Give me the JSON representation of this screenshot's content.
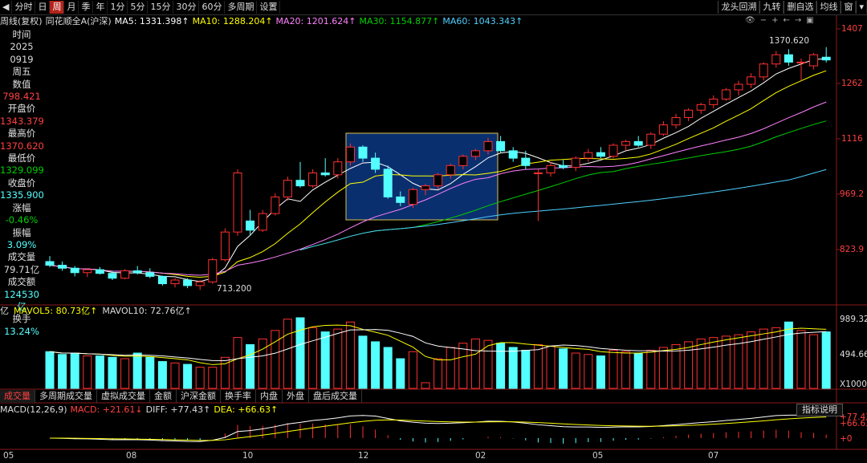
{
  "toolbar": {
    "left_icon": "back-icon",
    "periods": [
      "分时",
      "日",
      "周",
      "月",
      "季",
      "年",
      "1分",
      "5分",
      "15分",
      "30分",
      "60分",
      "多周期",
      "设置"
    ],
    "active_period": "周",
    "right": [
      "龙头回溯",
      "九转",
      "删自选",
      "均线",
      "窗"
    ],
    "more_icon": "chevron-down-icon"
  },
  "legend": {
    "mode": "周线(复权)",
    "name": "同花顺全A(沪深)",
    "ma5": "MA5: 1331.398↑",
    "ma10": "MA10: 1288.204↑",
    "ma20": "MA20: 1201.624↑",
    "ma30": "MA30: 1154.877↑",
    "ma60": "MA60: 1043.343↑"
  },
  "side": {
    "time_label": "时间",
    "year": "2025",
    "date": "0919",
    "weekday": "周五",
    "value_label": "数值",
    "value": "798.421",
    "open_label": "开盘价",
    "open": "1343.379",
    "high_label": "最高价",
    "high": "1370.620",
    "low_label": "最低价",
    "low": "1329.099",
    "close_label": "收盘价",
    "close": "1335.900",
    "chg_label": "涨幅",
    "chg": "-0.46%",
    "amp_label": "振幅",
    "amp": "3.09%",
    "vol_label": "成交量",
    "vol": "79.71亿",
    "amt_label": "成交额",
    "amt": "124530亿",
    "turn_label": "换手",
    "turn": "13.24%"
  },
  "price_axis": [
    "1407",
    "1262",
    "1116",
    "969.2",
    "823.9"
  ],
  "high_marker": "1370.620",
  "low_marker": "713.200",
  "vol_axis": [
    "989.32",
    "494.66",
    "X1000"
  ],
  "volume_legend": {
    "prefix": "亿",
    "mavol5": "MAVOL5: 80.73亿↑",
    "mavol10": "MAVOL10: 72.76亿↑"
  },
  "tabs": [
    "成交量",
    "多周期成交量",
    "虚拟成交量",
    "金额",
    "沪深金额",
    "换手率",
    "内盘",
    "外盘",
    "盘后成交量"
  ],
  "active_tab": "成交量",
  "macd": {
    "label": "MACD(12,26,9)",
    "macd": "MACD: +21.61↓",
    "diff": "DIFF: +77.43↑",
    "dea": "DEA: +66.63↑",
    "help": "指标说明",
    "axis": [
      "+77.43",
      "+66.63",
      "+0"
    ]
  },
  "months": [
    "05",
    "08",
    "10",
    "12",
    "02",
    "05",
    "07"
  ],
  "toolbar_icons": [
    "eye-icon",
    "minus-icon",
    "plus-icon",
    "left-icon",
    "right-icon",
    "expand-icon"
  ],
  "colors": {
    "up": "#ff3030",
    "down": "#54ffff",
    "ma5": "#ffffff",
    "ma10": "#ffff00",
    "ma20": "#ff80ff",
    "ma30": "#00d000",
    "ma60": "#4fd0ff",
    "highlight": "#0a2f6e"
  },
  "chart_data": {
    "type": "candlestick",
    "ylim": [
      690,
      1420
    ],
    "candles": [
      [
        790,
        805,
        775,
        780
      ],
      [
        780,
        790,
        765,
        772
      ],
      [
        772,
        778,
        750,
        760
      ],
      [
        760,
        770,
        748,
        768
      ],
      [
        768,
        775,
        755,
        758
      ],
      [
        758,
        765,
        740,
        745
      ],
      [
        745,
        770,
        742,
        765
      ],
      [
        765,
        778,
        755,
        760
      ],
      [
        760,
        772,
        745,
        750
      ],
      [
        750,
        752,
        725,
        730
      ],
      [
        730,
        745,
        720,
        740
      ],
      [
        740,
        745,
        718,
        725
      ],
      [
        725,
        740,
        713,
        735
      ],
      [
        735,
        800,
        730,
        795
      ],
      [
        795,
        880,
        790,
        870
      ],
      [
        870,
        1040,
        860,
        1030
      ],
      [
        900,
        930,
        860,
        875
      ],
      [
        875,
        930,
        870,
        920
      ],
      [
        920,
        975,
        915,
        965
      ],
      [
        965,
        1020,
        955,
        1010
      ],
      [
        1010,
        1060,
        990,
        995
      ],
      [
        995,
        1040,
        990,
        1030
      ],
      [
        1030,
        1070,
        1020,
        1025
      ],
      [
        1025,
        1070,
        1015,
        1060
      ],
      [
        1060,
        1110,
        1050,
        1100
      ],
      [
        1100,
        1105,
        1060,
        1070
      ],
      [
        1070,
        1085,
        1030,
        1040
      ],
      [
        1040,
        1050,
        960,
        965
      ],
      [
        965,
        980,
        940,
        950
      ],
      [
        945,
        990,
        935,
        985
      ],
      [
        985,
        1000,
        970,
        995
      ],
      [
        995,
        1030,
        985,
        1025
      ],
      [
        1025,
        1055,
        1015,
        1050
      ],
      [
        1050,
        1080,
        1040,
        1075
      ],
      [
        1075,
        1095,
        1065,
        1090
      ],
      [
        1090,
        1125,
        1080,
        1115
      ],
      [
        1115,
        1130,
        1085,
        1090
      ],
      [
        1090,
        1100,
        1060,
        1070
      ],
      [
        1070,
        1090,
        1040,
        1050
      ],
      [
        1030,
        1040,
        900,
        1030
      ],
      [
        1030,
        1060,
        1020,
        1050
      ],
      [
        1050,
        1065,
        1040,
        1045
      ],
      [
        1045,
        1075,
        1035,
        1070
      ],
      [
        1070,
        1095,
        1060,
        1085
      ],
      [
        1085,
        1100,
        1070,
        1075
      ],
      [
        1075,
        1110,
        1070,
        1105
      ],
      [
        1105,
        1120,
        1090,
        1115
      ],
      [
        1115,
        1130,
        1100,
        1105
      ],
      [
        1105,
        1140,
        1095,
        1135
      ],
      [
        1135,
        1170,
        1130,
        1160
      ],
      [
        1160,
        1190,
        1150,
        1180
      ],
      [
        1180,
        1205,
        1170,
        1200
      ],
      [
        1200,
        1220,
        1190,
        1215
      ],
      [
        1215,
        1240,
        1205,
        1230
      ],
      [
        1230,
        1260,
        1225,
        1255
      ],
      [
        1255,
        1280,
        1240,
        1270
      ],
      [
        1270,
        1300,
        1260,
        1290
      ],
      [
        1290,
        1330,
        1280,
        1325
      ],
      [
        1325,
        1360,
        1315,
        1350
      ],
      [
        1350,
        1365,
        1320,
        1330
      ],
      [
        1330,
        1340,
        1280,
        1330
      ],
      [
        1320,
        1355,
        1310,
        1350
      ],
      [
        1343.379,
        1370.62,
        1329.099,
        1335.9
      ]
    ],
    "volumes": [
      52,
      48,
      50,
      46,
      46,
      44,
      42,
      50,
      44,
      38,
      36,
      34,
      30,
      30,
      44,
      72,
      62,
      70,
      82,
      98,
      100,
      86,
      80,
      84,
      94,
      74,
      66,
      58,
      42,
      52,
      8,
      42,
      58,
      64,
      70,
      68,
      64,
      58,
      54,
      62,
      60,
      56,
      50,
      48,
      46,
      54,
      52,
      50,
      54,
      58,
      62,
      66,
      70,
      72,
      74,
      76,
      80,
      84,
      86,
      94,
      82,
      76,
      80
    ]
  }
}
